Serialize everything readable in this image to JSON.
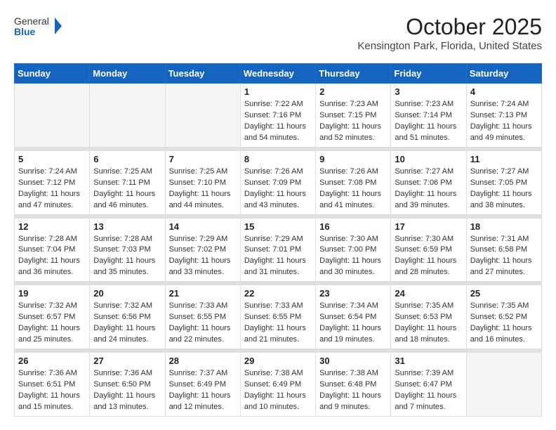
{
  "header": {
    "logo_general": "General",
    "logo_blue": "Blue",
    "month_title": "October 2025",
    "location": "Kensington Park, Florida, United States"
  },
  "days_of_week": [
    "Sunday",
    "Monday",
    "Tuesday",
    "Wednesday",
    "Thursday",
    "Friday",
    "Saturday"
  ],
  "weeks": [
    [
      {
        "day": "",
        "empty": true
      },
      {
        "day": "",
        "empty": true
      },
      {
        "day": "",
        "empty": true
      },
      {
        "day": "1",
        "sunrise": "7:22 AM",
        "sunset": "7:16 PM",
        "daylight": "11 hours and 54 minutes."
      },
      {
        "day": "2",
        "sunrise": "7:23 AM",
        "sunset": "7:15 PM",
        "daylight": "11 hours and 52 minutes."
      },
      {
        "day": "3",
        "sunrise": "7:23 AM",
        "sunset": "7:14 PM",
        "daylight": "11 hours and 51 minutes."
      },
      {
        "day": "4",
        "sunrise": "7:24 AM",
        "sunset": "7:13 PM",
        "daylight": "11 hours and 49 minutes."
      }
    ],
    [
      {
        "day": "5",
        "sunrise": "7:24 AM",
        "sunset": "7:12 PM",
        "daylight": "11 hours and 47 minutes."
      },
      {
        "day": "6",
        "sunrise": "7:25 AM",
        "sunset": "7:11 PM",
        "daylight": "11 hours and 46 minutes."
      },
      {
        "day": "7",
        "sunrise": "7:25 AM",
        "sunset": "7:10 PM",
        "daylight": "11 hours and 44 minutes."
      },
      {
        "day": "8",
        "sunrise": "7:26 AM",
        "sunset": "7:09 PM",
        "daylight": "11 hours and 43 minutes."
      },
      {
        "day": "9",
        "sunrise": "7:26 AM",
        "sunset": "7:08 PM",
        "daylight": "11 hours and 41 minutes."
      },
      {
        "day": "10",
        "sunrise": "7:27 AM",
        "sunset": "7:06 PM",
        "daylight": "11 hours and 39 minutes."
      },
      {
        "day": "11",
        "sunrise": "7:27 AM",
        "sunset": "7:05 PM",
        "daylight": "11 hours and 38 minutes."
      }
    ],
    [
      {
        "day": "12",
        "sunrise": "7:28 AM",
        "sunset": "7:04 PM",
        "daylight": "11 hours and 36 minutes."
      },
      {
        "day": "13",
        "sunrise": "7:28 AM",
        "sunset": "7:03 PM",
        "daylight": "11 hours and 35 minutes."
      },
      {
        "day": "14",
        "sunrise": "7:29 AM",
        "sunset": "7:02 PM",
        "daylight": "11 hours and 33 minutes."
      },
      {
        "day": "15",
        "sunrise": "7:29 AM",
        "sunset": "7:01 PM",
        "daylight": "11 hours and 31 minutes."
      },
      {
        "day": "16",
        "sunrise": "7:30 AM",
        "sunset": "7:00 PM",
        "daylight": "11 hours and 30 minutes."
      },
      {
        "day": "17",
        "sunrise": "7:30 AM",
        "sunset": "6:59 PM",
        "daylight": "11 hours and 28 minutes."
      },
      {
        "day": "18",
        "sunrise": "7:31 AM",
        "sunset": "6:58 PM",
        "daylight": "11 hours and 27 minutes."
      }
    ],
    [
      {
        "day": "19",
        "sunrise": "7:32 AM",
        "sunset": "6:57 PM",
        "daylight": "11 hours and 25 minutes."
      },
      {
        "day": "20",
        "sunrise": "7:32 AM",
        "sunset": "6:56 PM",
        "daylight": "11 hours and 24 minutes."
      },
      {
        "day": "21",
        "sunrise": "7:33 AM",
        "sunset": "6:55 PM",
        "daylight": "11 hours and 22 minutes."
      },
      {
        "day": "22",
        "sunrise": "7:33 AM",
        "sunset": "6:55 PM",
        "daylight": "11 hours and 21 minutes."
      },
      {
        "day": "23",
        "sunrise": "7:34 AM",
        "sunset": "6:54 PM",
        "daylight": "11 hours and 19 minutes."
      },
      {
        "day": "24",
        "sunrise": "7:35 AM",
        "sunset": "6:53 PM",
        "daylight": "11 hours and 18 minutes."
      },
      {
        "day": "25",
        "sunrise": "7:35 AM",
        "sunset": "6:52 PM",
        "daylight": "11 hours and 16 minutes."
      }
    ],
    [
      {
        "day": "26",
        "sunrise": "7:36 AM",
        "sunset": "6:51 PM",
        "daylight": "11 hours and 15 minutes."
      },
      {
        "day": "27",
        "sunrise": "7:36 AM",
        "sunset": "6:50 PM",
        "daylight": "11 hours and 13 minutes."
      },
      {
        "day": "28",
        "sunrise": "7:37 AM",
        "sunset": "6:49 PM",
        "daylight": "11 hours and 12 minutes."
      },
      {
        "day": "29",
        "sunrise": "7:38 AM",
        "sunset": "6:49 PM",
        "daylight": "11 hours and 10 minutes."
      },
      {
        "day": "30",
        "sunrise": "7:38 AM",
        "sunset": "6:48 PM",
        "daylight": "11 hours and 9 minutes."
      },
      {
        "day": "31",
        "sunrise": "7:39 AM",
        "sunset": "6:47 PM",
        "daylight": "11 hours and 7 minutes."
      },
      {
        "day": "",
        "empty": true
      }
    ]
  ],
  "labels": {
    "sunrise": "Sunrise:",
    "sunset": "Sunset:",
    "daylight": "Daylight:"
  }
}
